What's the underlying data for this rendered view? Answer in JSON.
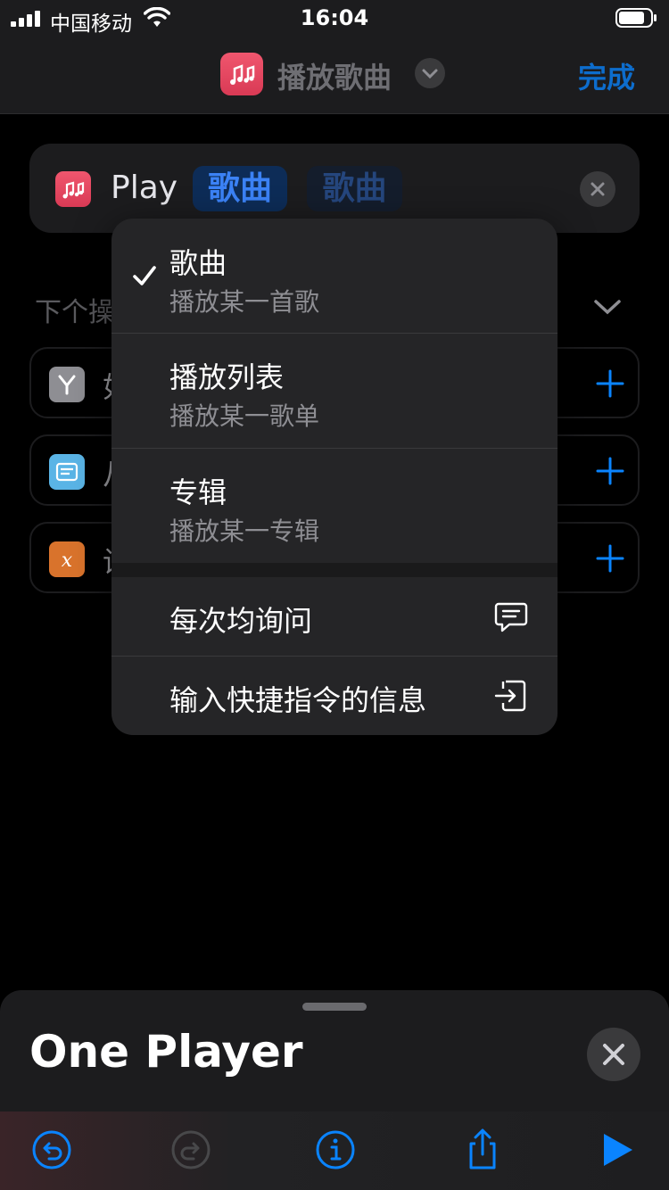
{
  "status_bar": {
    "carrier": "中国移动",
    "time": "16:04"
  },
  "nav": {
    "title": "播放歌曲",
    "done_label": "完成",
    "app_icon": "music-icon",
    "accent": "#0a84ff"
  },
  "action_card": {
    "verb": "Play",
    "selected_token": "歌曲",
    "secondary_token": "歌曲"
  },
  "next_actions": {
    "label": "下个操",
    "items": [
      {
        "label": "如",
        "icon": "branch-icon",
        "color": "#8e8e93"
      },
      {
        "label": "从",
        "icon": "menu-card-icon",
        "color": "#5ab4e6"
      },
      {
        "label": "设",
        "icon": "variable-icon",
        "color": "#d9732c"
      }
    ]
  },
  "menu": {
    "options": [
      {
        "title": "歌曲",
        "subtitle": "播放某一首歌",
        "checked": true
      },
      {
        "title": "播放列表",
        "subtitle": "播放某一歌单",
        "checked": false
      },
      {
        "title": "专辑",
        "subtitle": "播放某一专辑",
        "checked": false
      }
    ],
    "actions": [
      {
        "title": "每次均询问",
        "icon": "message-icon"
      },
      {
        "title": "输入快捷指令的信息",
        "icon": "input-arrow-icon"
      }
    ]
  },
  "sheet": {
    "title": "One Player",
    "toolbar": [
      "undo-icon",
      "redo-icon",
      "info-icon",
      "share-icon",
      "play-icon"
    ]
  }
}
